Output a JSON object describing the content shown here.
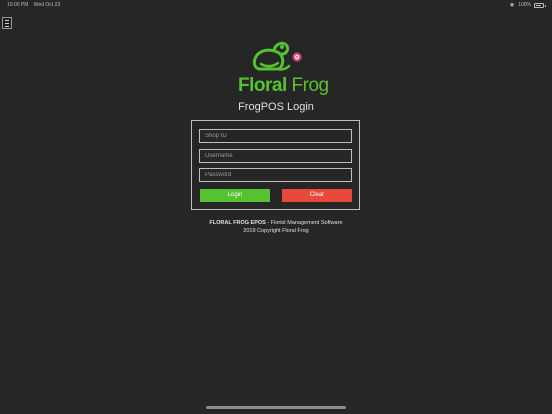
{
  "status_bar": {
    "time": "10:00 PM",
    "date": "Wed Oct 23",
    "wifi": "wifi-icon",
    "battery_percent": "100%",
    "battery": "battery-icon"
  },
  "logo": {
    "text_part1": "Floral",
    "text_part2": "Frog",
    "icon": "frog-flower-icon",
    "colors": {
      "green": "#55c232",
      "flower": "#e0457b"
    }
  },
  "login": {
    "title": "FrogPOS Login",
    "shop_id_placeholder": "Shop ID",
    "username_placeholder": "Username",
    "password_placeholder": "Password",
    "login_label": "Login",
    "clear_label": "Clear",
    "colors": {
      "login": "#55c232",
      "clear": "#e74a3b"
    }
  },
  "footer": {
    "brand": "FLORAL FROG EPOS",
    "tagline": " - Florist Management Software",
    "copyright": "2019 Copyright Floral Frog"
  }
}
